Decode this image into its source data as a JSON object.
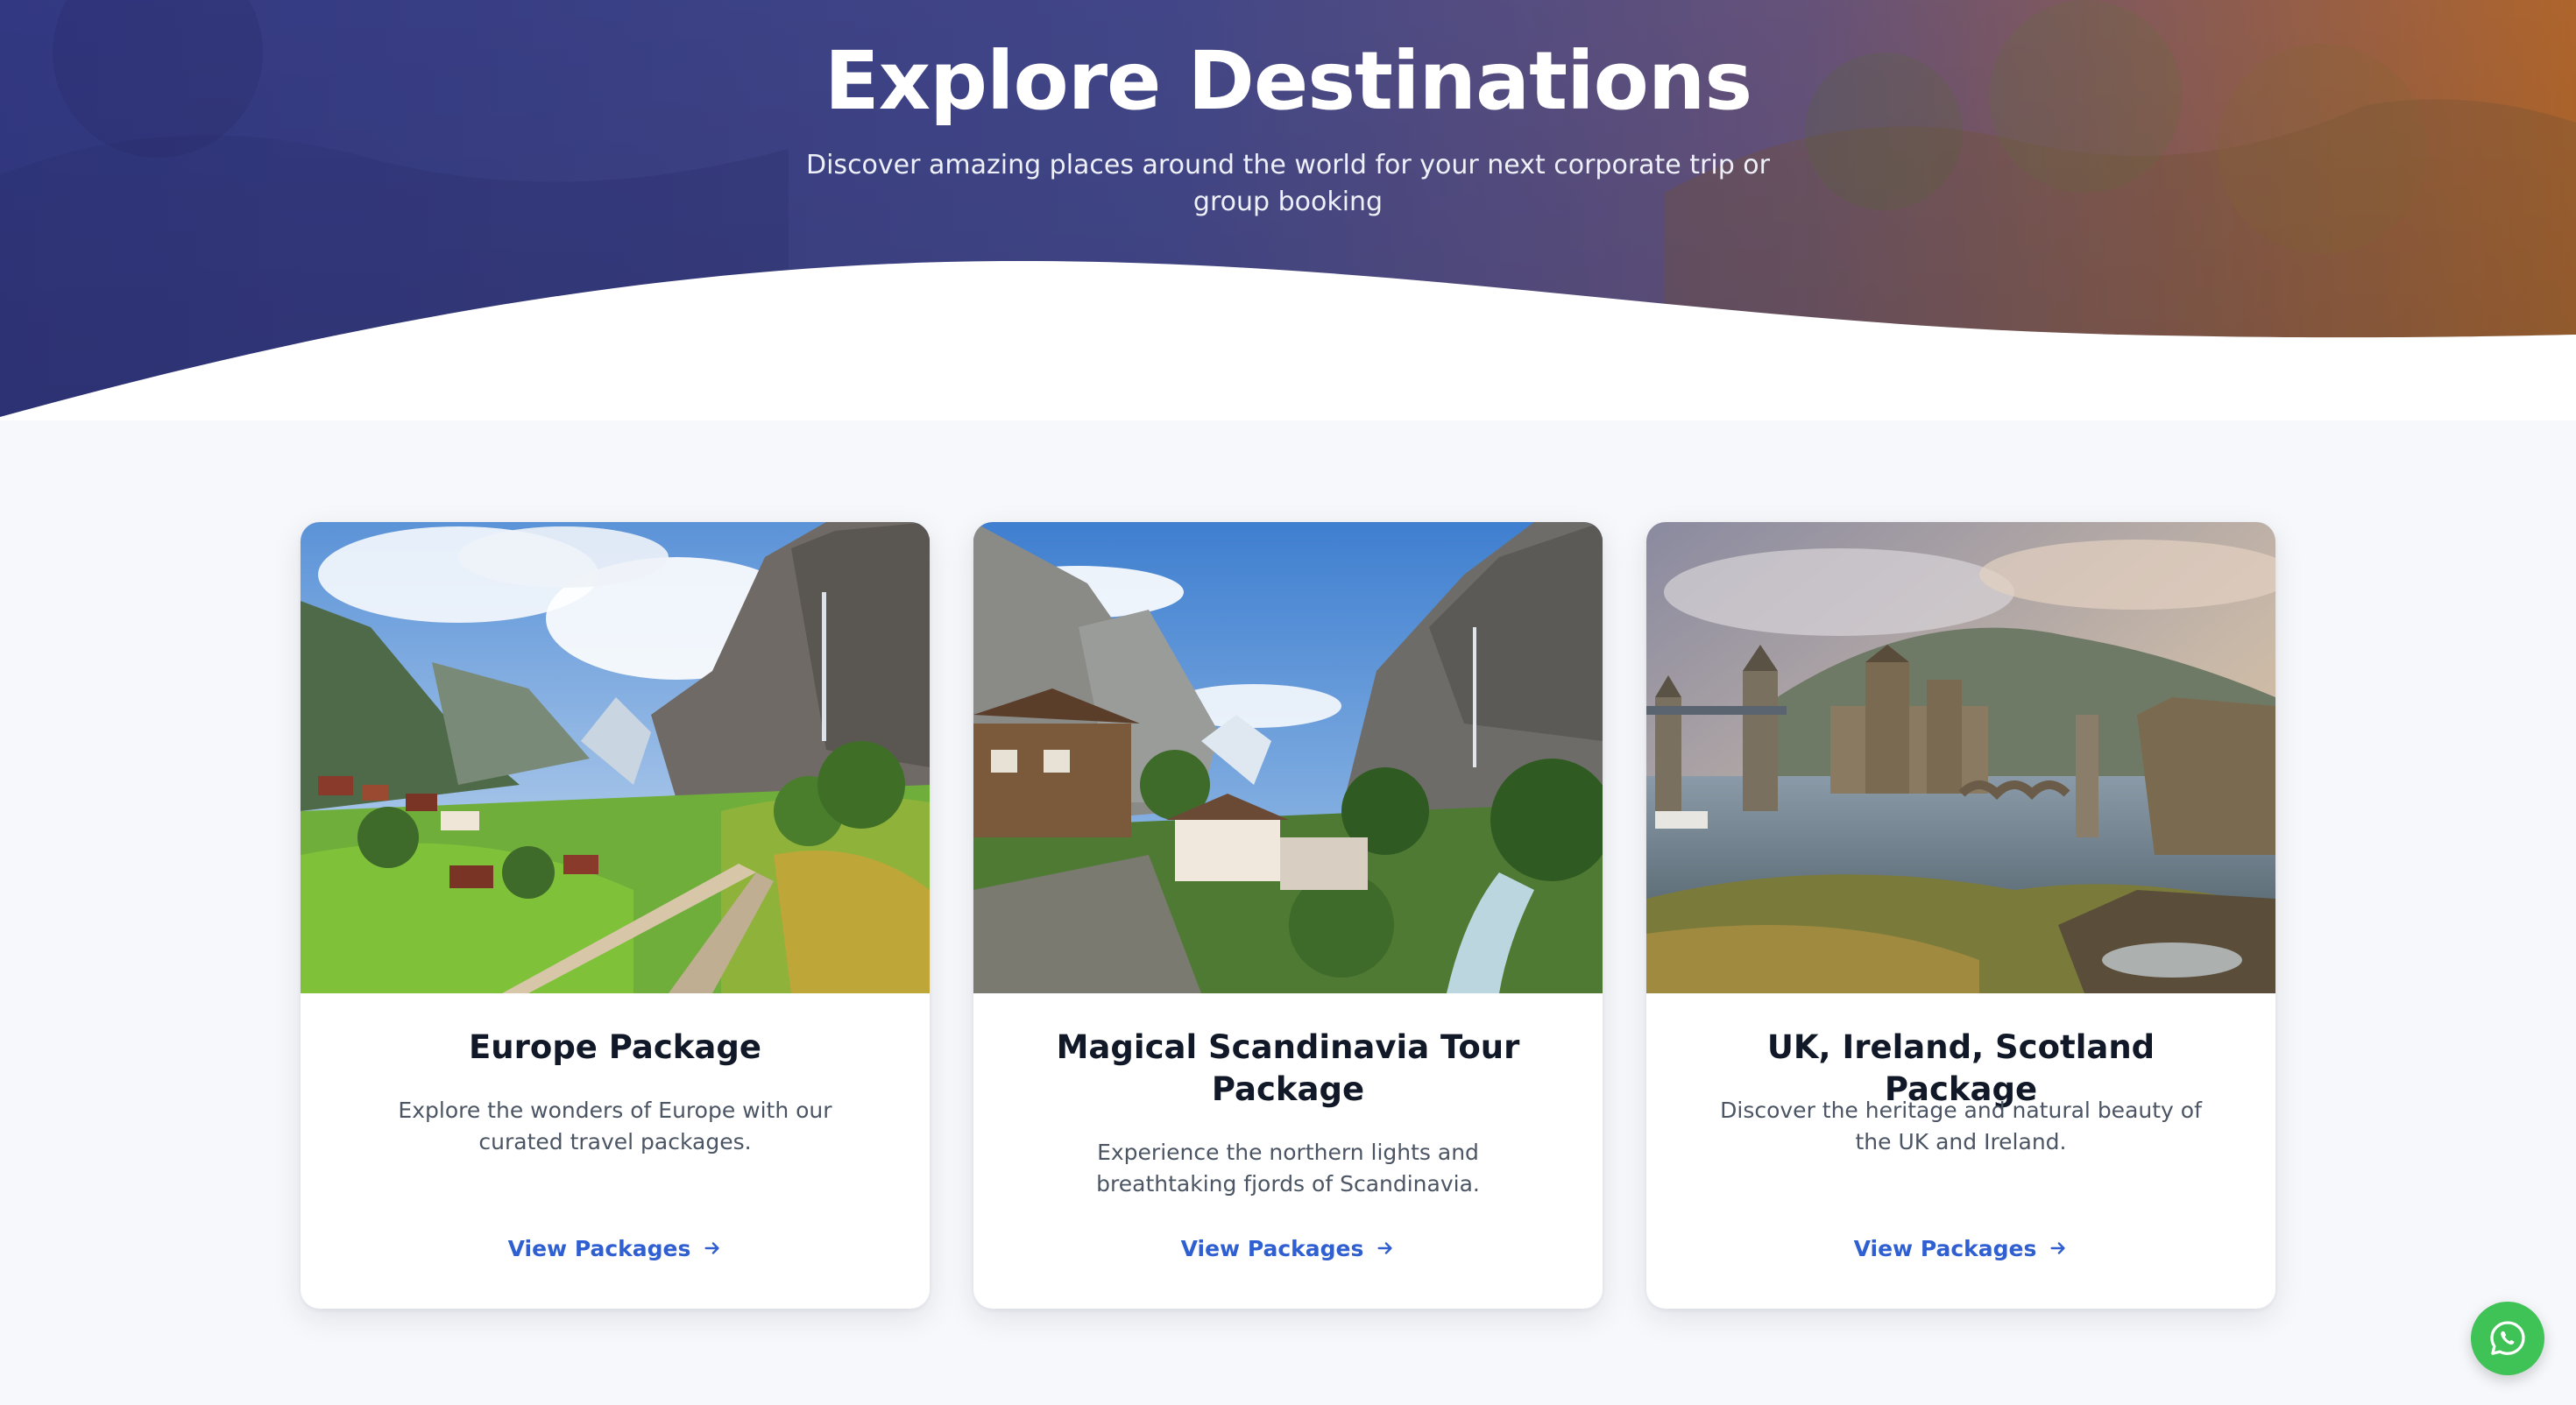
{
  "hero": {
    "title": "Explore Destinations",
    "subtitle": "Discover amazing places around the world for your next corporate trip or group booking"
  },
  "cards": [
    {
      "title": "Europe Package",
      "description": "Explore the wonders of Europe with our curated travel packages.",
      "link_label": "View Packages",
      "image": "alpine-valley-waterfall-village"
    },
    {
      "title": "Magical Scandinavia Tour Package",
      "description": "Experience the northern lights and breathtaking fjords of Scandinavia.",
      "link_label": "View Packages",
      "image": "mountain-valley-river-chalets"
    },
    {
      "title": "UK, Ireland, Scotland Package",
      "description": "Discover the heritage and natural beauty of the UK and Ireland.",
      "link_label": "View Packages",
      "image": "castle-bridge-coastal-cliffs"
    }
  ],
  "icons": {
    "link_arrow": "arrow-right-icon",
    "chat": "whatsapp-icon"
  },
  "colors": {
    "hero_gradient_start": "#3a3f8f",
    "hero_gradient_end": "#b4672f",
    "link": "#2f5fd0",
    "title": "#111827",
    "description": "#4b5563",
    "whatsapp": "#3fc256",
    "page_background": "#f7f8fb"
  }
}
